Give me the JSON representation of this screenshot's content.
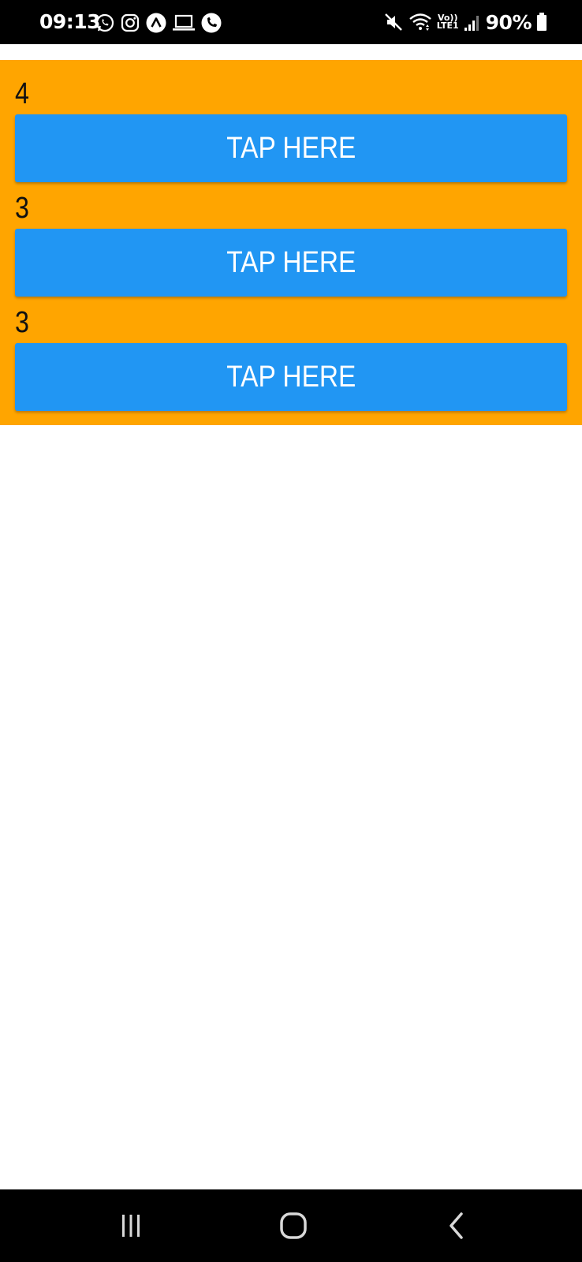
{
  "status_bar": {
    "time": "09:13",
    "battery_percent": "90%",
    "left_icons": [
      "whatsapp-icon",
      "instagram-icon",
      "app-circle-icon",
      "laptop-icon",
      "phone-icon"
    ],
    "right_icons": [
      "mute-icon",
      "wifi-icon",
      "volte-lte-icon",
      "signal-icon",
      "battery-icon"
    ],
    "volte_top": "Vo))",
    "volte_bottom": "LTE1"
  },
  "counters": [
    {
      "value": "4",
      "button_label": "TAP HERE"
    },
    {
      "value": "3",
      "button_label": "TAP HERE"
    },
    {
      "value": "3",
      "button_label": "TAP HERE"
    }
  ],
  "colors": {
    "panel": "#FFA500",
    "button": "#2196F3",
    "button_text": "#FFFFFF",
    "counter_text": "#111111",
    "system_bars": "#000000"
  },
  "nav_bar": {
    "icons": [
      "recents-icon",
      "home-icon",
      "back-icon"
    ]
  }
}
